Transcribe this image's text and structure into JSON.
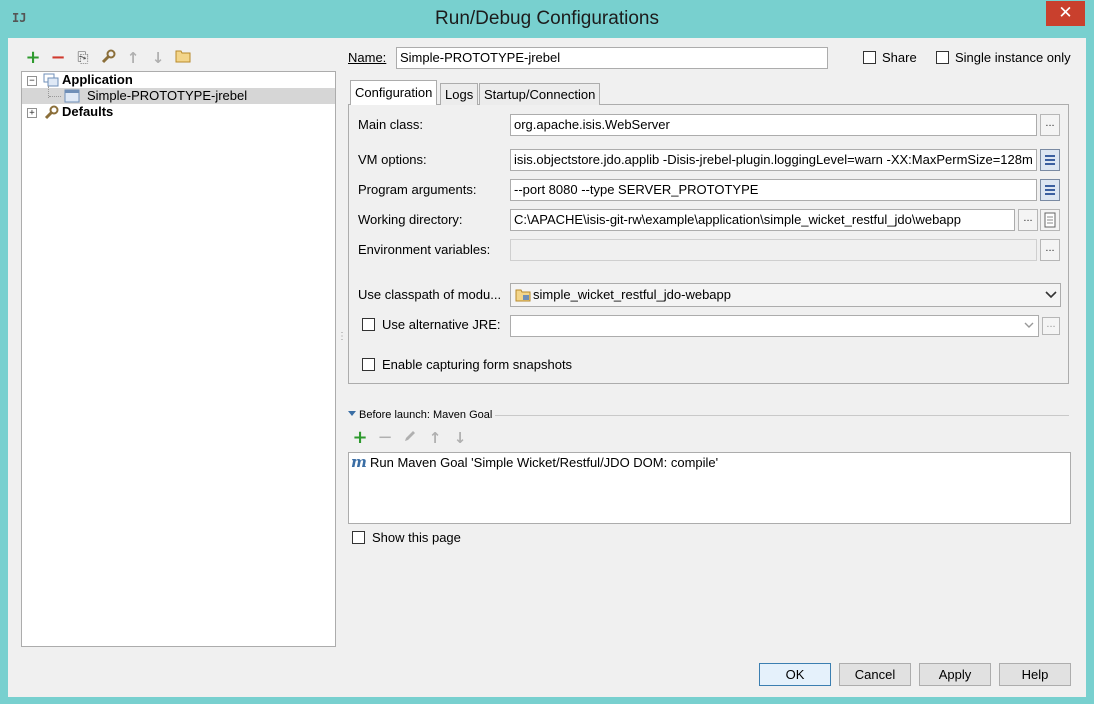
{
  "window": {
    "title": "Run/Debug Configurations",
    "close_glyph": "✕",
    "icon": "intellij-icon"
  },
  "left_toolbar": {
    "buttons": [
      {
        "name": "add-config-button",
        "icon": "plus-icon",
        "glyph": "+",
        "color": "#2e9a2e"
      },
      {
        "name": "remove-config-button",
        "icon": "minus-icon",
        "glyph": "−",
        "color": "#d03a2e"
      },
      {
        "name": "copy-config-button",
        "icon": "copy-icon",
        "glyph": "⎘",
        "color": "#555555"
      },
      {
        "name": "edit-defaults-button",
        "icon": "wrench-icon",
        "glyph": "🔧",
        "color": "#8b6f3a"
      },
      {
        "name": "move-up-button",
        "icon": "arrow-up-icon",
        "glyph": "↑",
        "color": "#b0b0b0"
      },
      {
        "name": "move-down-button",
        "icon": "arrow-down-icon",
        "glyph": "↓",
        "color": "#b0b0b0"
      },
      {
        "name": "folder-button",
        "icon": "folder-icon",
        "glyph": "▭",
        "color": "#c89a3a"
      }
    ]
  },
  "tree": {
    "application_label": "Application",
    "config_label": "Simple-PROTOTYPE-jrebel",
    "defaults_label": "Defaults"
  },
  "name_field": {
    "label": "Name:",
    "value": "Simple-PROTOTYPE-jrebel"
  },
  "share": {
    "label": "Share",
    "checked": false
  },
  "single_instance": {
    "label": "Single instance only",
    "checked": false
  },
  "tabs": [
    {
      "label": "Configuration",
      "active": true
    },
    {
      "label": "Logs",
      "active": false
    },
    {
      "label": "Startup/Connection",
      "active": false
    }
  ],
  "form": {
    "main_class": {
      "label": "Main class:",
      "value": "org.apache.isis.WebServer"
    },
    "vm_options": {
      "label": "VM options:",
      "value": "isis.objectstore.jdo.applib -Disis-jrebel-plugin.loggingLevel=warn -XX:MaxPermSize=128m"
    },
    "program_args": {
      "label": "Program arguments:",
      "value": "--port 8080 --type SERVER_PROTOTYPE"
    },
    "working_dir": {
      "label": "Working directory:",
      "value": "C:\\APACHE\\isis-git-rw\\example\\application\\simple_wicket_restful_jdo\\webapp"
    },
    "env_vars": {
      "label": "Environment variables:",
      "value": ""
    },
    "classpath": {
      "label": "Use classpath of modu...",
      "value": "simple_wicket_restful_jdo-webapp"
    },
    "alt_jre": {
      "label": "Use alternative JRE:",
      "checked": false,
      "value": ""
    },
    "snapshots": {
      "label": "Enable capturing form snapshots",
      "checked": false
    },
    "dots": "..."
  },
  "before_launch": {
    "header": "Before launch: Maven Goal",
    "items": [
      {
        "icon": "maven-icon",
        "glyph": "m",
        "label": "Run Maven Goal 'Simple Wicket/Restful/JDO DOM: compile'"
      }
    ]
  },
  "show_page": {
    "label": "Show this page",
    "checked": false
  },
  "buttons": {
    "ok": "OK",
    "cancel": "Cancel",
    "apply": "Apply",
    "help": "Help"
  }
}
